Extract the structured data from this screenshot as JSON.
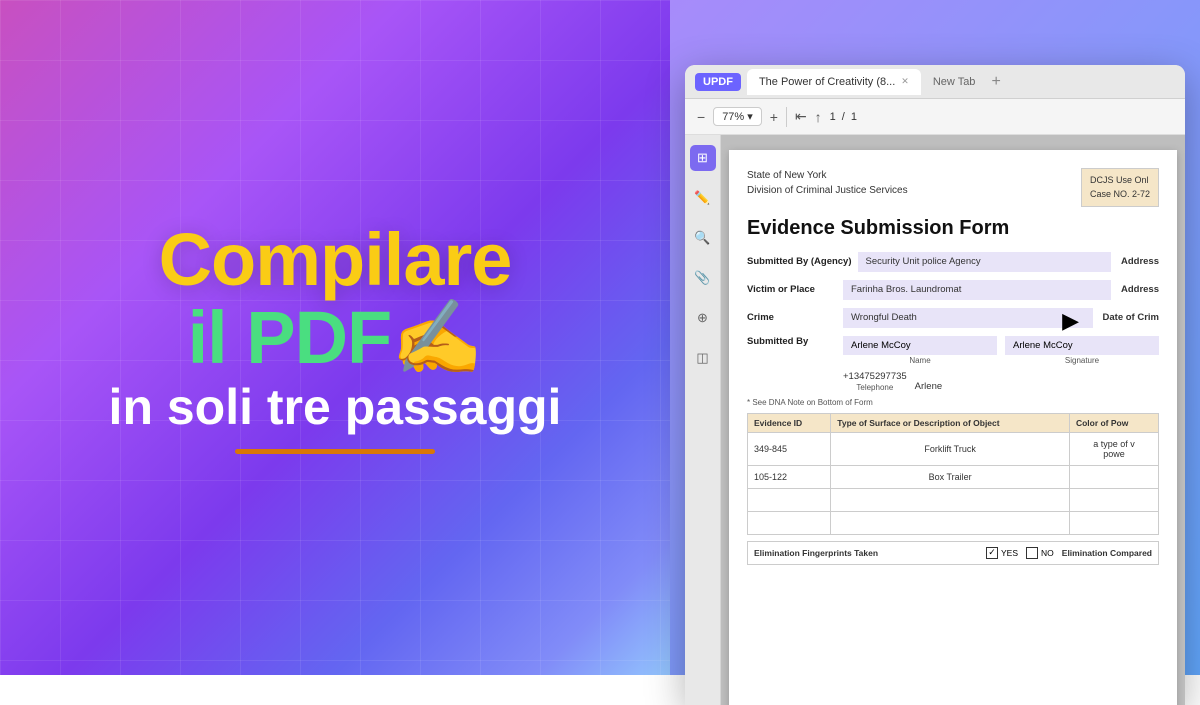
{
  "left": {
    "line1": "Compilare",
    "line2": "il PDF✍️",
    "line3": "in soli tre passaggi"
  },
  "app": {
    "logo": "UPDF",
    "tab_active": "The Power of Creativity (8...",
    "tab_inactive": "New Tab",
    "zoom": "77%",
    "page_current": "1",
    "page_total": "1"
  },
  "document": {
    "state": "State of New York",
    "division": "Division of Criminal Justice Services",
    "dcjs_label": "DCJS Use Onl",
    "case_no": "Case NO. 2-72",
    "title": "Evidence Submission Form",
    "submitted_by_label": "Submitted By (Agency)",
    "submitted_by_value": "Security Unit police Agency",
    "address_label1": "Address",
    "victim_label": "Victim or Place",
    "victim_value": "Farinha Bros. Laundromat",
    "address_label2": "Address",
    "crime_label": "Crime",
    "crime_value": "Wrongful Death",
    "date_crime_label": "Date of Crim",
    "submitted_by2_label": "Submitted By",
    "name_value": "Arlene McCoy",
    "signature_value": "Arlene McCoy",
    "name_label": "Name",
    "signature_label": "Signature",
    "phone_value": "+13475297735",
    "phone_label": "Telephone",
    "arlene_extra": "Arlene",
    "dna_note": "* See DNA Note on Bottom of Form",
    "table_headers": [
      "Evidence ID",
      "Type of Surface or Description of Object",
      "Color of Pow"
    ],
    "table_rows": [
      {
        "id": "349-845",
        "type": "Forklift Truck",
        "color": "a type of v\npowe"
      },
      {
        "id": "105-122",
        "type": "Box Trailer",
        "color": ""
      },
      {
        "id": "",
        "type": "",
        "color": ""
      },
      {
        "id": "",
        "type": "",
        "color": ""
      }
    ],
    "fp_label": "Elimination Fingerprints Taken",
    "fp_yes": "YES",
    "fp_no": "NO",
    "fp_compared_label": "Elimination Compared"
  }
}
